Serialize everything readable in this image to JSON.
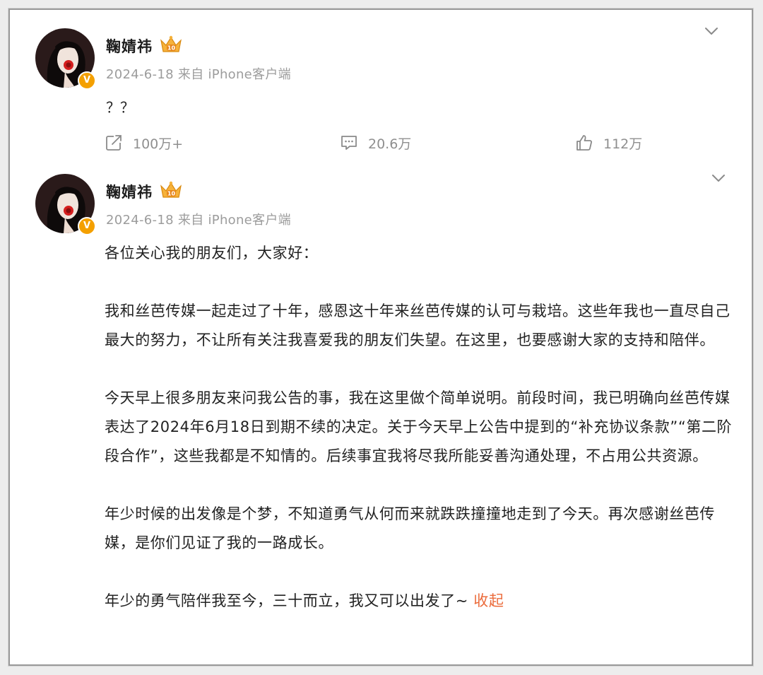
{
  "posts": [
    {
      "author": "鞠婧祎",
      "meta": "2024-6-18 来自 iPhone客户端",
      "text": "？？",
      "actions": {
        "repost": "100万+",
        "comment": "20.6万",
        "like": "112万"
      }
    },
    {
      "author": "鞠婧祎",
      "meta": "2024-6-18 来自 iPhone客户端",
      "paragraphs": [
        "各位关心我的朋友们，大家好：",
        "我和丝芭传媒一起走过了十年，感恩这十年来丝芭传媒的认可与栽培。这些年我也一直尽自己最大的努力，不让所有关注我喜爱我的朋友们失望。在这里，也要感谢大家的支持和陪伴。",
        "今天早上很多朋友来问我公告的事，我在这里做个简单说明。前段时间，我已明确向丝芭传媒表达了2024年6月18日到期不续的决定。关于今天早上公告中提到的“补充协议条款”“第二阶段合作”，这些我都是不知情的。后续事宜我将尽我所能妥善沟通处理，不占用公共资源。",
        "年少时候的出发像是个梦，不知道勇气从何而来就跌跌撞撞地走到了今天。再次感谢丝芭传媒，是你们见证了我的一路成长。",
        "年少的勇气陪伴我至今，三十而立，我又可以出发了~"
      ],
      "collapse_label": "收起"
    }
  ],
  "badge": {
    "level": "10",
    "verified_mark": "V"
  },
  "colors": {
    "accent": "#eb6b3b",
    "meta": "#9c9c9c",
    "verified": "#f4a000"
  }
}
